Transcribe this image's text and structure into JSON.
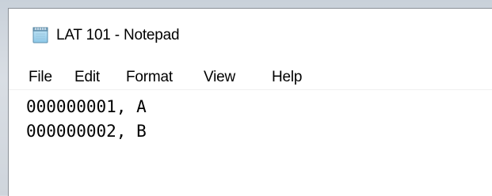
{
  "window": {
    "title": "LAT 101 - Notepad",
    "app_icon": "notepad-icon"
  },
  "menu": {
    "items": [
      {
        "label": "File"
      },
      {
        "label": "Edit"
      },
      {
        "label": "Format"
      },
      {
        "label": "View"
      },
      {
        "label": "Help"
      }
    ]
  },
  "editor": {
    "lines": [
      "000000001, A",
      "000000002, B"
    ]
  }
}
